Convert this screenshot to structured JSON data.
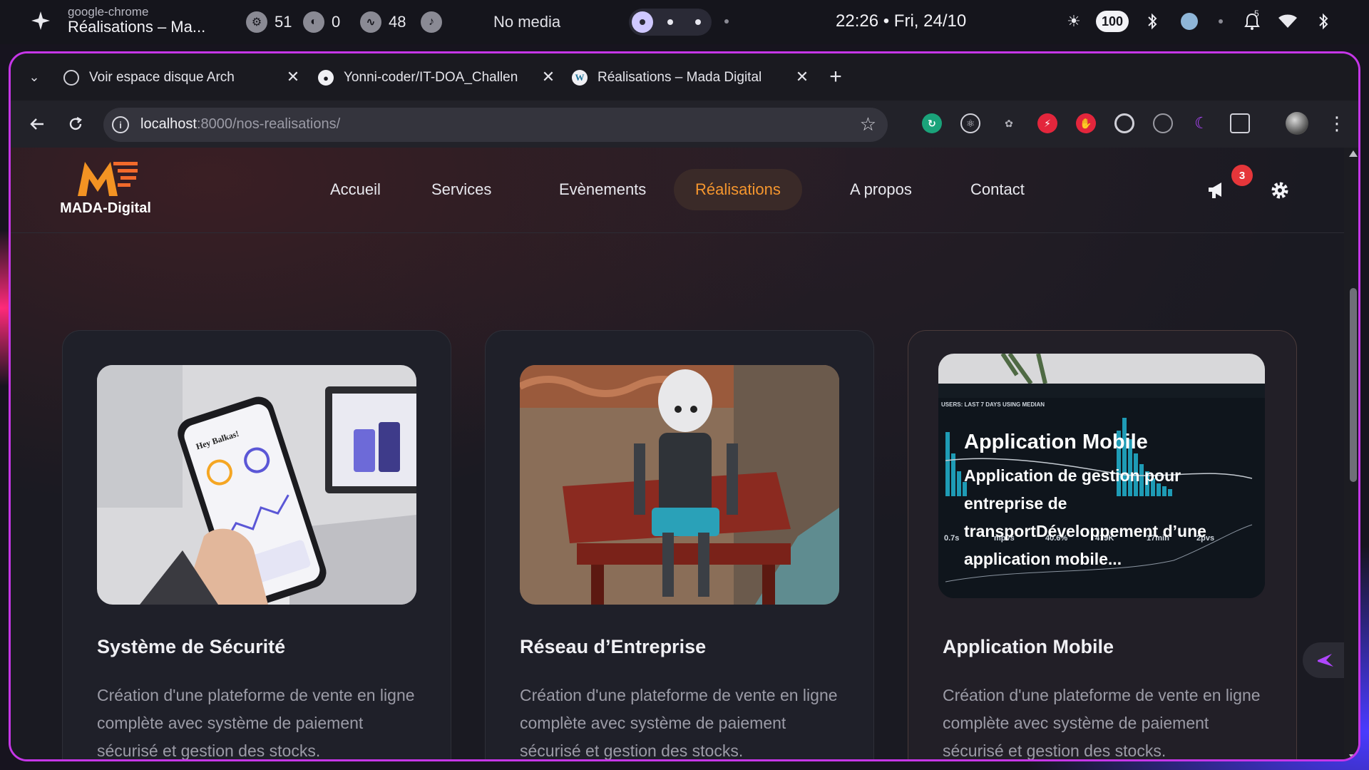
{
  "system_bar": {
    "app_sub": "google-chrome",
    "app_title": "Réalisations – Ma...",
    "stats": [
      {
        "icon": "cpu-icon",
        "value": "51"
      },
      {
        "icon": "disk-icon",
        "value": "0"
      },
      {
        "icon": "memory-icon",
        "value": "48"
      }
    ],
    "media": "No media",
    "clock": "22:26 • Fri, 24/10",
    "battery": "100",
    "notifications_count": "5"
  },
  "browser": {
    "tabs": [
      {
        "title": "Voir espace disque Arch",
        "icon": "openai-icon"
      },
      {
        "title": "Yonni-coder/IT-DOA_Challen",
        "icon": "github-icon"
      },
      {
        "title": "Réalisations – Mada Digital",
        "icon": "wordpress-icon"
      }
    ],
    "url_host": "localhost",
    "url_rest": ":8000/nos-realisations/"
  },
  "site": {
    "logo_text": "MADA-Digital",
    "nav": [
      {
        "label": "Accueil"
      },
      {
        "label": "Services"
      },
      {
        "label": "Evènements"
      },
      {
        "label": "Réalisations"
      },
      {
        "label": "A propos"
      },
      {
        "label": "Contact"
      }
    ],
    "notif_badge": "3"
  },
  "cards": [
    {
      "title": "Système de Sécurité",
      "description": "Création d'une plateforme de vente en ligne complète avec système de paiement sécurisé et gestion des stocks.",
      "image": "phone-dashboard-photo"
    },
    {
      "title": "Réseau d’Entreprise",
      "description": "Création d'une plateforme de vente en ligne complète avec système de paiement sécurisé et gestion des stocks.",
      "image": "robot-on-bench-photo"
    },
    {
      "title": "Application Mobile",
      "description": "Création d'une plateforme de vente en ligne complète avec système de paiement sécurisé et gestion des stocks.",
      "image": "analytics-dashboard-photo",
      "overlay_title": "Application Mobile",
      "overlay_desc": "Application de gestion pour entreprise de transportDéveloppement d’une application mobile...",
      "dashboard_header": "USERS: LAST 7 DAYS USING MEDIAN",
      "dashboard_stats": [
        "0.7s",
        "mpvs",
        "40.6%",
        "479K",
        "17min",
        "2pvs"
      ]
    }
  ],
  "colors": {
    "accent": "#f5962e",
    "window_border": "#c636e8",
    "badge": "#e5363a"
  }
}
